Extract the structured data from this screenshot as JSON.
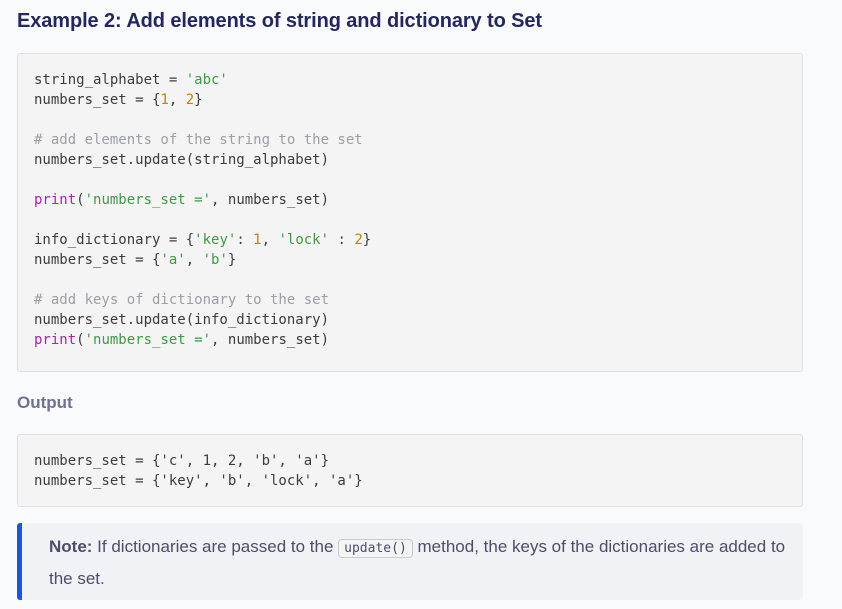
{
  "heading": "Example 2: Add elements of string and dictionary to Set",
  "code": {
    "l1_a": "string_alphabet = ",
    "l1_b": "'abc'",
    "l2_a": "numbers_set = {",
    "l2_b": "1",
    "l2_c": ", ",
    "l2_d": "2",
    "l2_e": "}",
    "l3": "# add elements of the string to the set",
    "l4": "numbers_set.update(string_alphabet)",
    "l5_a": "print",
    "l5_b": "(",
    "l5_c": "'numbers_set ='",
    "l5_d": ", numbers_set)",
    "l6_a": "info_dictionary = {",
    "l6_b": "'key'",
    "l6_c": ": ",
    "l6_d": "1",
    "l6_e": ", ",
    "l6_f": "'lock'",
    "l6_g": " : ",
    "l6_h": "2",
    "l6_i": "}",
    "l7_a": "numbers_set = {",
    "l7_b": "'a'",
    "l7_c": ", ",
    "l7_d": "'b'",
    "l7_e": "}",
    "l8": "# add keys of dictionary to the set",
    "l9": "numbers_set.update(info_dictionary)",
    "l10_a": "print",
    "l10_b": "(",
    "l10_c": "'numbers_set ='",
    "l10_d": ", numbers_set)"
  },
  "output_label": "Output",
  "output": {
    "l1": "numbers_set = {'c', 1, 2, 'b', 'a'}",
    "l2": "numbers_set = {'key', 'b', 'lock', 'a'}"
  },
  "note": {
    "title": "Note:",
    "text_before": " If dictionaries are passed to the ",
    "code": "update()",
    "text_after": " method, the keys of the dictionaries are added to the set."
  },
  "colors": {
    "heading": "#25265e",
    "accent": "#1a56db",
    "string": "#3d9a45",
    "number": "#b8860b",
    "comment": "#9aa0a6",
    "function": "#a626a4"
  }
}
